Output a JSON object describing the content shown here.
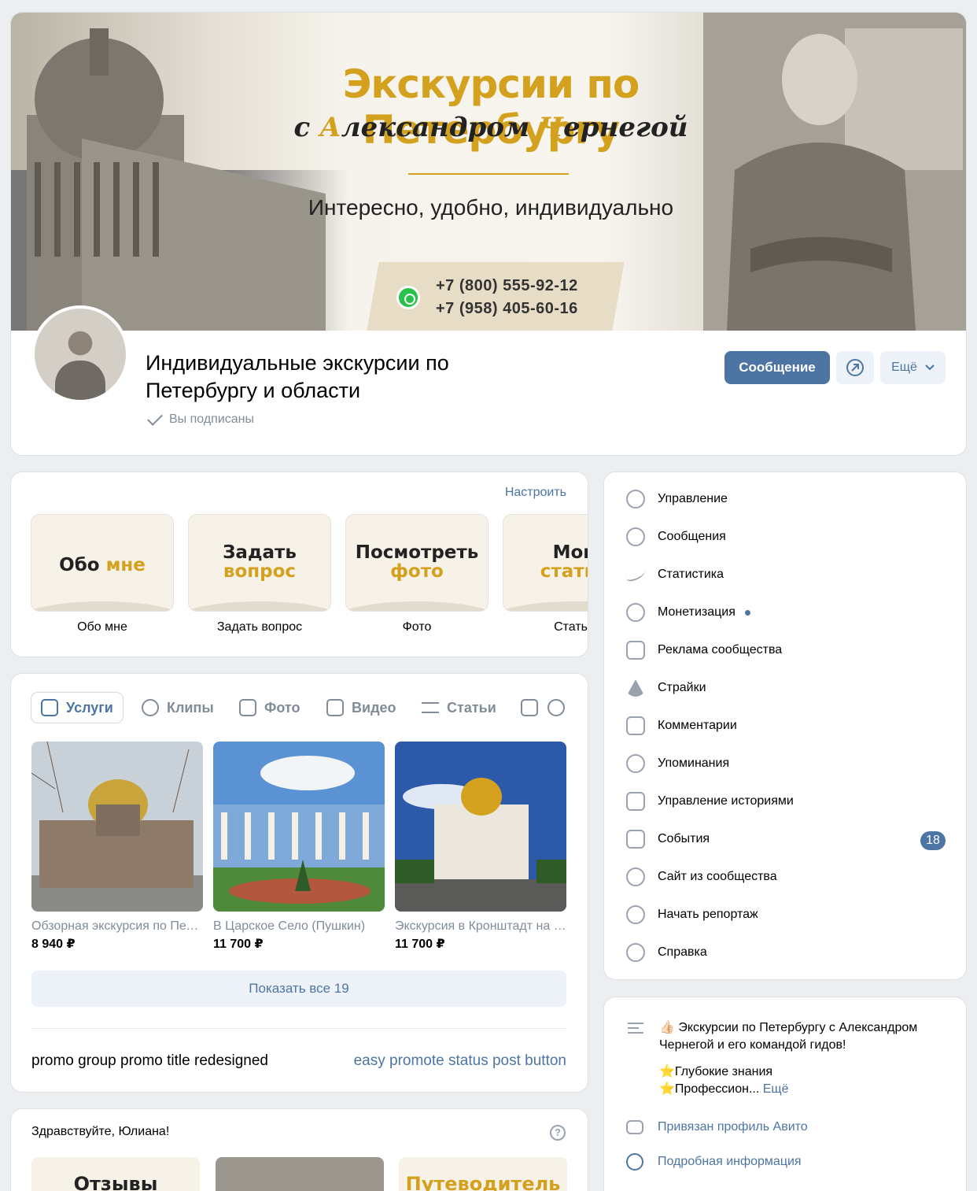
{
  "cover": {
    "title": "Экскурсии по Петербургу",
    "subtitle_pre": "с ",
    "subtitle_a": "А",
    "subtitle_mid": "лександром ",
    "subtitle_ch": "Ч",
    "subtitle_post": "ернегой",
    "tagline": "Интересно, удобно, индивидуально",
    "phone1": "+7 (800) 555-92-12",
    "phone2": "+7 (958) 405-60-16"
  },
  "group": {
    "title": "Индивидуальные экскурсии по Петербургу и области",
    "subscribed": "Вы подписаны",
    "message_btn": "Сообщение",
    "more_btn": "Ещё"
  },
  "quick": {
    "setup": "Настроить",
    "tiles": [
      {
        "t1": "Обо ",
        "t2": "мне",
        "label": "Обо мне"
      },
      {
        "t1": "Задать",
        "t2": "вопрос",
        "label": "Задать вопрос"
      },
      {
        "t1": "Посмотреть",
        "t2": "фото",
        "label": "Фото"
      },
      {
        "t1": "Мои",
        "t2": "статьи",
        "label": "Статьи"
      }
    ]
  },
  "tabs": [
    "Услуги",
    "Клипы",
    "Фото",
    "Видео",
    "Статьи"
  ],
  "products": [
    {
      "name": "Обзорная экскурсия по Петербургу",
      "price": "8 940 ₽"
    },
    {
      "name": "В Царское Село (Пушкин)",
      "price": "11 700 ₽"
    },
    {
      "name": "Экскурсия в Кронштадт на автомобиле",
      "price": "11 700 ₽"
    }
  ],
  "show_all": "Показать все 19",
  "promo": {
    "left": "promo group promo title redesigned",
    "right": "easy promote status post button"
  },
  "greeting": {
    "text": "Здравствуйте, Юлиана!",
    "help": "?",
    "tiles": [
      "Отзывы",
      "",
      "Путеводитель"
    ]
  },
  "menu": [
    "Управление",
    "Сообщения",
    "Статистика",
    "Монетизация",
    "Реклама сообщества",
    "Страйки",
    "Комментарии",
    "Упоминания",
    "Управление историями",
    "События",
    "Сайт из сообщества",
    "Начать репортаж",
    "Справка"
  ],
  "events_badge": "18",
  "about": {
    "line1": "👍🏻 Экскурсии по Петербургу с Александром Чернегой и его командой гидов!",
    "line2": "⭐Глубокие знания",
    "line3": "⭐Профессион...",
    "more": "Ещё",
    "avito": "Привязан профиль Авито",
    "info": "Подробная информация"
  },
  "colors": {
    "accent": "#4c75a3",
    "gold": "#d4a11f",
    "bg": "#edeef0"
  }
}
